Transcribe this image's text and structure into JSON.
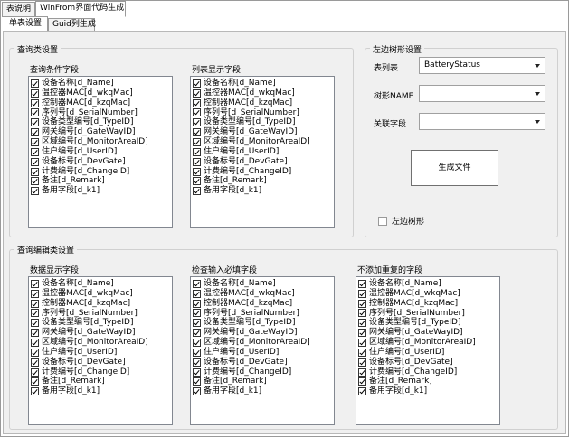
{
  "outer_tabs": [
    "表说明",
    "WinFrom界面代码生成"
  ],
  "inner_tabs": [
    "单表设置",
    "Guid列生成"
  ],
  "query_group": {
    "title": "查询类设置",
    "condition_label": "查询条件字段",
    "display_label": "列表显示字段"
  },
  "tree_group": {
    "title": "左边树形设置",
    "table_label": "表列表",
    "table_value": "BatteryStatus",
    "tree_name_label": "树形NAME",
    "tree_name_value": "",
    "relation_label": "关联字段",
    "relation_value": "",
    "generate_button": "生成文件",
    "left_tree_checkbox": "左边树形"
  },
  "edit_group": {
    "title": "查询编辑类设置",
    "data_label": "数据显示字段",
    "required_label": "检查输入必填字段",
    "no_dup_label": "不添加重复的字段"
  },
  "fields": [
    "设备名称[d_Name]",
    "温控器MAC[d_wkqMac]",
    "控制器MAC[d_kzqMac]",
    "序列号[d_SerialNumber]",
    "设备类型编号[d_TypeID]",
    "网关编号[d_GateWayID]",
    "区域编号[d_MonitorAreaID]",
    "住户编号[d_UserID]",
    "设备标号[d_DevGate]",
    "计费编号[d_ChangeID]",
    "备注[d_Remark]",
    "备用字段[d_k1]"
  ]
}
